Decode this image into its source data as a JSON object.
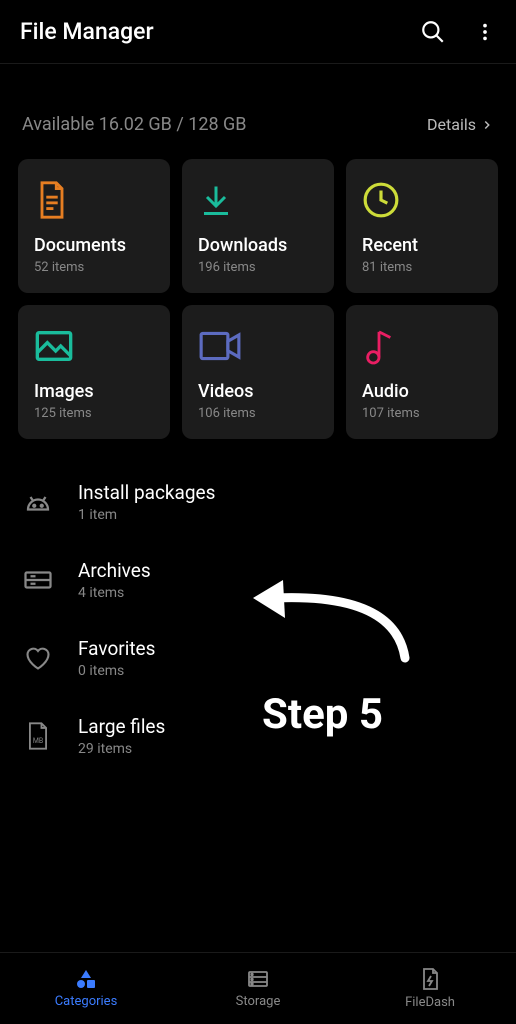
{
  "header": {
    "title": "File Manager"
  },
  "storage": {
    "text": "Available 16.02 GB / 128 GB",
    "details_label": "Details"
  },
  "cards": [
    {
      "title": "Documents",
      "sub": "52 items",
      "icon": "document",
      "color": "#e67e22"
    },
    {
      "title": "Downloads",
      "sub": "196 items",
      "icon": "download",
      "color": "#1abc9c"
    },
    {
      "title": "Recent",
      "sub": "81 items",
      "icon": "clock",
      "color": "#cddc39"
    },
    {
      "title": "Images",
      "sub": "125 items",
      "icon": "image",
      "color": "#1abc9c"
    },
    {
      "title": "Videos",
      "sub": "106 items",
      "icon": "video",
      "color": "#5c6bc0"
    },
    {
      "title": "Audio",
      "sub": "107 items",
      "icon": "audio",
      "color": "#e91e63"
    }
  ],
  "list": [
    {
      "title": "Install packages",
      "sub": "1 item",
      "icon": "android"
    },
    {
      "title": "Archives",
      "sub": "4 items",
      "icon": "archive"
    },
    {
      "title": "Favorites",
      "sub": "0 items",
      "icon": "heart"
    },
    {
      "title": "Large files",
      "sub": "29 items",
      "icon": "file-mb"
    }
  ],
  "nav": [
    {
      "label": "Categories",
      "icon": "categories",
      "active": true
    },
    {
      "label": "Storage",
      "icon": "storage",
      "active": false
    },
    {
      "label": "FileDash",
      "icon": "filedash",
      "active": false
    }
  ],
  "annotation": {
    "step_label": "Step 5"
  }
}
